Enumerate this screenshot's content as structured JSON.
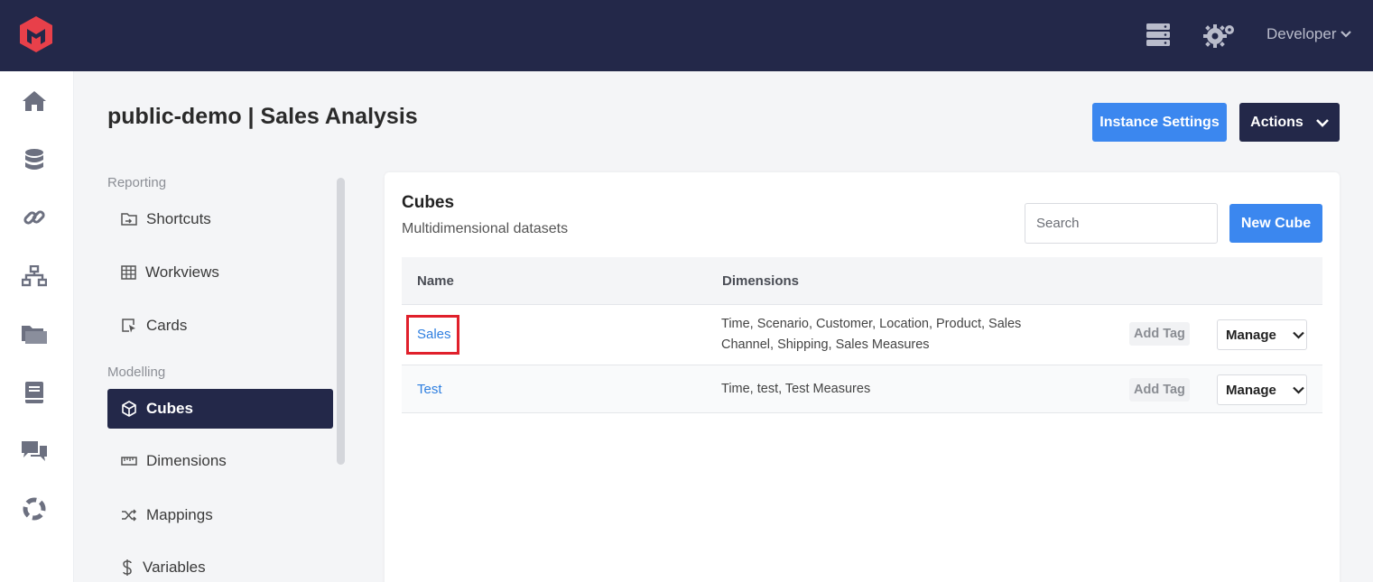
{
  "topbar": {
    "logo": "brand-logo",
    "icons": [
      "server-icon",
      "gears-icon"
    ],
    "user_label": "Developer"
  },
  "rail": {
    "icons": [
      "home-icon",
      "database-icon",
      "link-icon",
      "sitemap-icon",
      "folder-icon",
      "book-icon",
      "comments-icon",
      "lifebuoy-icon"
    ]
  },
  "header": {
    "title": "public-demo | Sales Analysis",
    "instance_settings_label": "Instance Settings",
    "actions_label": "Actions"
  },
  "nav": {
    "sections": [
      {
        "label": "Reporting",
        "items": [
          {
            "label": "Shortcuts",
            "icon": "folder-shortcut-icon"
          },
          {
            "label": "Workviews",
            "icon": "table-icon"
          },
          {
            "label": "Cards",
            "icon": "card-pointer-icon"
          }
        ]
      },
      {
        "label": "Modelling",
        "items": [
          {
            "label": "Cubes",
            "icon": "cube-icon",
            "active": true
          },
          {
            "label": "Dimensions",
            "icon": "ruler-icon"
          },
          {
            "label": "Mappings",
            "icon": "shuffle-icon"
          },
          {
            "label": "Variables",
            "icon": "dollar-icon"
          }
        ]
      }
    ]
  },
  "cubes": {
    "title": "Cubes",
    "subtitle": "Multidimensional datasets",
    "search_placeholder": "Search",
    "new_label": "New Cube",
    "columns": [
      "Name",
      "Dimensions"
    ],
    "rows": [
      {
        "name": "Sales",
        "dimensions": "Time, Scenario, Customer, Location, Product, Sales Channel, Shipping, Sales Measures",
        "tag_label": "Add Tag",
        "manage_label": "Manage",
        "highlighted": true
      },
      {
        "name": "Test",
        "dimensions": "Time, test, Test Measures",
        "tag_label": "Add Tag",
        "manage_label": "Manage",
        "highlighted": false
      }
    ]
  },
  "colors": {
    "topbar": "#232849",
    "primary": "#3b87ef",
    "dark": "#232849",
    "link": "#2f7fe0",
    "highlight": "#e0202b"
  }
}
